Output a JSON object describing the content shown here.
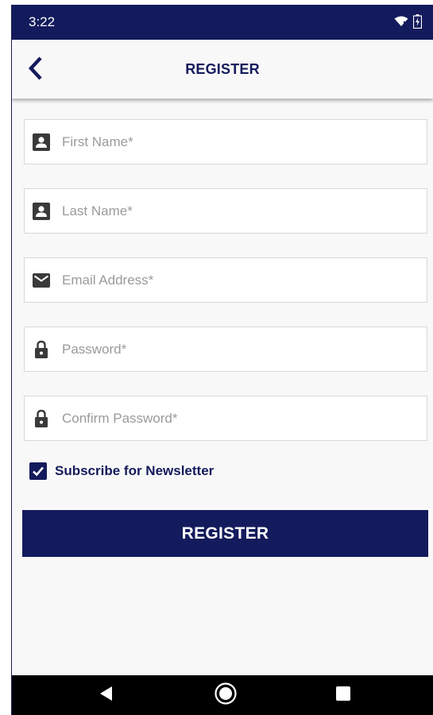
{
  "status_bar": {
    "time": "3:22",
    "icons": [
      "wifi-icon",
      "battery-charging-icon"
    ],
    "color": "#141b5c"
  },
  "app_bar": {
    "back_icon": "chevron-left-icon",
    "title": "REGISTER"
  },
  "form": {
    "fields": [
      {
        "icon": "person-icon",
        "placeholder": "First Name*",
        "value": ""
      },
      {
        "icon": "person-icon",
        "placeholder": "Last Name*",
        "value": ""
      },
      {
        "icon": "mail-icon",
        "placeholder": "Email Address*",
        "value": ""
      },
      {
        "icon": "lock-icon",
        "placeholder": "Password*",
        "value": ""
      },
      {
        "icon": "lock-icon",
        "placeholder": "Confirm Password*",
        "value": ""
      }
    ],
    "newsletter": {
      "label": "Subscribe for Newsletter",
      "checked": true
    },
    "submit_label": "REGISTER"
  },
  "nav_bar": {
    "buttons": [
      "back-triangle-icon",
      "home-circle-icon",
      "recents-square-icon"
    ]
  },
  "colors": {
    "primary": "#141b5c",
    "background": "#f8f8f8",
    "field_border": "#d7d7d7",
    "placeholder": "#9a9a9a"
  }
}
